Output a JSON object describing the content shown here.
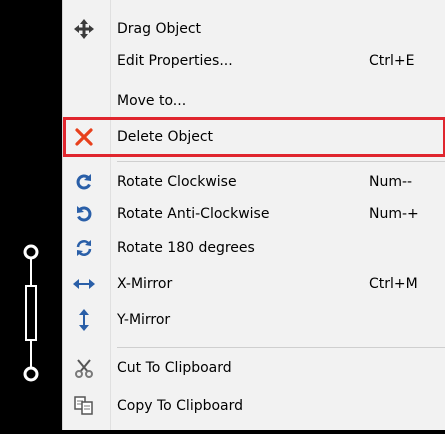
{
  "menu": {
    "items": [
      {
        "label": "Drag Object",
        "shortcut": "",
        "icon": "move-arrows-icon"
      },
      {
        "label": "Edit Properties...",
        "shortcut": "Ctrl+E",
        "icon": ""
      },
      {
        "label": "Move to...",
        "shortcut": "",
        "icon": ""
      },
      {
        "label": "Delete Object",
        "shortcut": "",
        "icon": "delete-x-icon"
      },
      {
        "label": "Rotate Clockwise",
        "shortcut": "Num--",
        "icon": "rotate-clockwise-icon"
      },
      {
        "label": "Rotate Anti-Clockwise",
        "shortcut": "Num-+",
        "icon": "rotate-anticlockwise-icon"
      },
      {
        "label": "Rotate 180 degrees",
        "shortcut": "",
        "icon": "rotate-180-icon"
      },
      {
        "label": "X-Mirror",
        "shortcut": "Ctrl+M",
        "icon": "x-mirror-icon"
      },
      {
        "label": "Y-Mirror",
        "shortcut": "",
        "icon": "y-mirror-icon"
      },
      {
        "label": "Cut To Clipboard",
        "shortcut": "",
        "icon": "scissors-icon"
      },
      {
        "label": "Copy To Clipboard",
        "shortcut": "",
        "icon": "copy-icon"
      }
    ],
    "highlighted_item": "Delete Object"
  },
  "colors": {
    "menu_bg": "#f2f2f2",
    "highlight_border": "#e0262e",
    "icon_blue": "#2a5fa8",
    "delete_red": "#e8401c",
    "canvas_bg": "#000000"
  }
}
